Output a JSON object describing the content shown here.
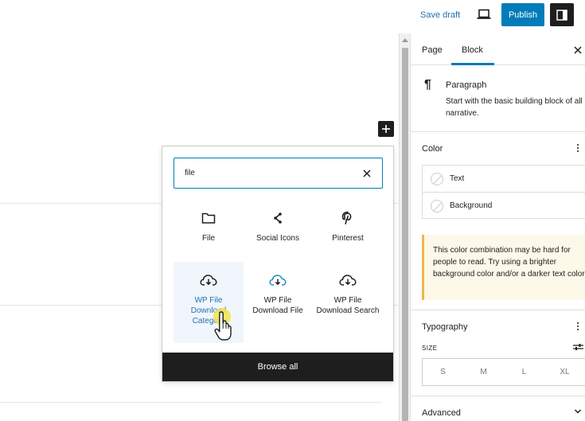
{
  "topbar": {
    "save_draft": "Save draft",
    "publish": "Publish"
  },
  "inserter": {
    "search_value": "file",
    "results": [
      {
        "label": "File",
        "icon": "folder-icon"
      },
      {
        "label": "Social Icons",
        "icon": "share-icon"
      },
      {
        "label": "Pinterest",
        "icon": "pinterest-icon"
      },
      {
        "label": "WP File Download Category",
        "icon": "cloud-download-icon",
        "active": true
      },
      {
        "label": "WP File Download File",
        "icon": "cloud-download-icon"
      },
      {
        "label": "WP File Download Search",
        "icon": "cloud-download-icon"
      }
    ],
    "browse_all": "Browse all"
  },
  "sidebar": {
    "tabs": [
      "Page",
      "Block"
    ],
    "active_tab": "Block",
    "block": {
      "title": "Paragraph",
      "description": "Start with the basic building block of all narrative."
    },
    "color": {
      "title": "Color",
      "items": [
        "Text",
        "Background"
      ]
    },
    "notice": "This color combination may be hard for people to read. Try using a brighter background color and/or a darker text color.",
    "typography": {
      "title": "Typography",
      "size_label": "SIZE",
      "sizes": [
        "S",
        "M",
        "L",
        "XL"
      ]
    },
    "advanced": "Advanced"
  },
  "colors": {
    "accent": "#007cba",
    "link": "#2271b1",
    "dark": "#1e1e1e",
    "notice_border": "#f0b849",
    "notice_bg": "#fcf9e8"
  }
}
